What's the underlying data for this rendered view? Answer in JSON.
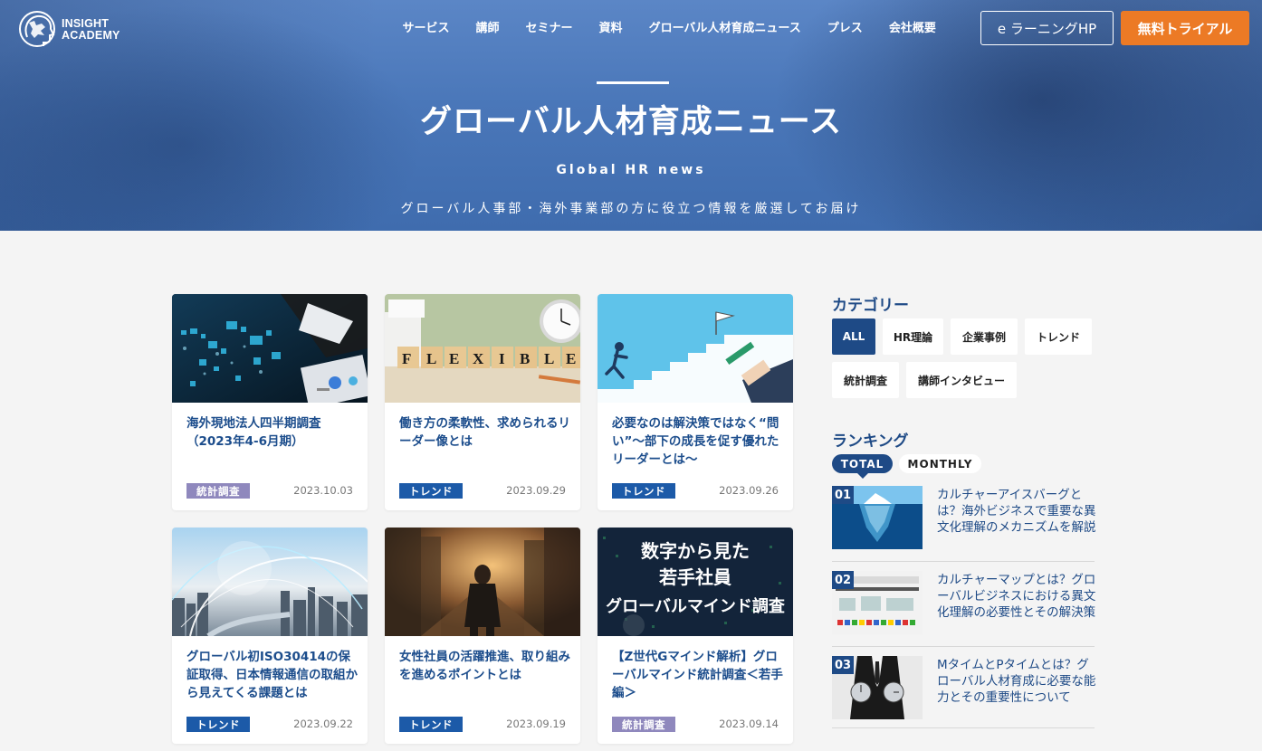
{
  "header": {
    "logo": {
      "line1": "INSIGHT",
      "line2": "ACADEMY"
    },
    "nav": [
      {
        "label": "サービス"
      },
      {
        "label": "講師"
      },
      {
        "label": "セミナー"
      },
      {
        "label": "資料"
      },
      {
        "label": "グローバル人材育成ニュース"
      },
      {
        "label": "プレス"
      },
      {
        "label": "会社概要"
      }
    ],
    "elearning_button": "e ラーニングHP",
    "trial_button": "無料トライアル"
  },
  "hero": {
    "title": "グローバル人材育成ニュース",
    "subtitle": "Global HR news",
    "description": "グローバル人事部・海外事業部の方に役立つ情報を厳選してお届け"
  },
  "articles": [
    {
      "title": "海外現地法人四半期調査（2023年4-6月期）",
      "tag": "統計調査",
      "tag_color": "#8f88bd",
      "date": "2023.10.03",
      "thumb": "world-map-data"
    },
    {
      "title": "働き方の柔軟性、求められるリーダー像とは",
      "tag": "トレンド",
      "tag_color": "#1c5aa8",
      "date": "2023.09.29",
      "thumb": "flexible-blocks"
    },
    {
      "title": "必要なのは解決策ではなく“問い”〜部下の成長を促す優れたリーダーとは〜",
      "tag": "トレンド",
      "tag_color": "#1c5aa8",
      "date": "2023.09.26",
      "thumb": "goal-stairs"
    },
    {
      "title": "グローバル初ISO30414の保証取得、日本情報通信の取組から見えてくる課題とは",
      "tag": "トレンド",
      "tag_color": "#1c5aa8",
      "date": "2023.09.22",
      "thumb": "city-network"
    },
    {
      "title": "女性社員の活躍推進、取り組みを進めるポイントとは",
      "tag": "トレンド",
      "tag_color": "#1c5aa8",
      "date": "2023.09.19",
      "thumb": "woman-city"
    },
    {
      "title": "【Z世代Gマインド解析】グローバルマインド統計調査＜若手編＞",
      "tag": "統計調査",
      "tag_color": "#8f88bd",
      "date": "2023.09.14",
      "thumb": "text-banner",
      "thumb_text": [
        "数字から見た",
        "若手社員",
        "グローバルマインド調査"
      ]
    }
  ],
  "sidebar": {
    "category_heading": "カテゴリー",
    "categories": [
      {
        "label": "ALL"
      },
      {
        "label": "HR理論"
      },
      {
        "label": "企業事例"
      },
      {
        "label": "トレンド"
      },
      {
        "label": "統計調査"
      },
      {
        "label": "講師インタビュー"
      }
    ],
    "ranking_heading": "ランキング",
    "ranking_tabs": [
      {
        "label": "TOTAL"
      },
      {
        "label": "MONTHLY"
      }
    ],
    "ranking": [
      {
        "num": "01",
        "title": "カルチャーアイスバーグとは？海外ビジネスで重要な異文化理解のメカニズムを解説",
        "thumb": "iceberg"
      },
      {
        "num": "02",
        "title": "カルチャーマップとは？グローバルビジネスにおける異文化理解の必要性とその解決策",
        "thumb": "culture-map"
      },
      {
        "num": "03",
        "title": "MタイムとPタイムとは？グローバル人材育成に必要な能力とその重要性について",
        "thumb": "businessman-clock"
      }
    ]
  },
  "colors": {
    "brand_navy": "#1e4a86",
    "accent_orange": "#ec7a25",
    "tag_trend": "#1c5aa8",
    "tag_stat": "#8f88bd"
  }
}
